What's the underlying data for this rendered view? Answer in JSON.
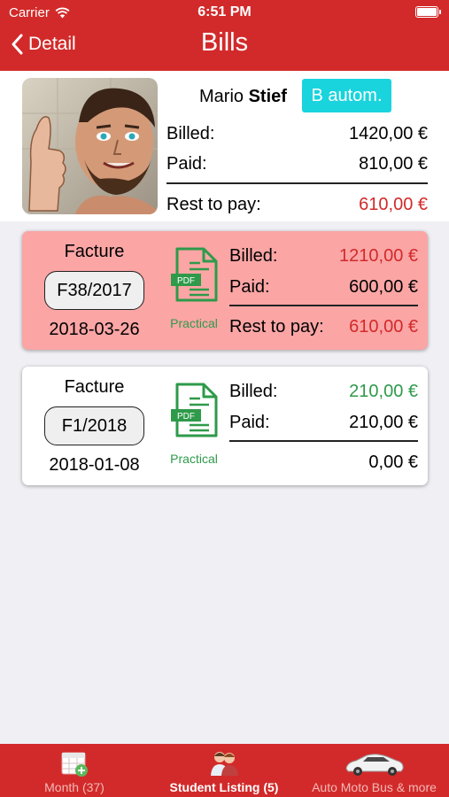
{
  "status_bar": {
    "carrier": "Carrier",
    "time": "6:51 PM"
  },
  "nav": {
    "back_label": "Detail",
    "title": "Bills"
  },
  "student": {
    "first_name": "Mario",
    "last_name": "Stief",
    "badge": "B autom.",
    "billed_label": "Billed:",
    "billed_value": "1420,00 €",
    "paid_label": "Paid:",
    "paid_value": "810,00 €",
    "rest_label": "Rest to pay:",
    "rest_value": "610,00 €"
  },
  "bills": [
    {
      "title": "Facture",
      "number": "F38/2017",
      "date": "2018-03-26",
      "pdf_label": "PDF",
      "category": "Practical",
      "billed_label": "Billed:",
      "billed_value": "1210,00 €",
      "paid_label": "Paid:",
      "paid_value": "600,00 €",
      "rest_label": "Rest to pay:",
      "rest_value": "610,00 €"
    },
    {
      "title": "Facture",
      "number": "F1/2018",
      "date": "2018-01-08",
      "pdf_label": "PDF",
      "category": "Practical",
      "billed_label": "Billed:",
      "billed_value": "210,00 €",
      "paid_label": "Paid:",
      "paid_value": "210,00 €",
      "rest_value": "0,00 €"
    }
  ],
  "tabs": [
    {
      "label": "Month (37)",
      "icon": "calendar-add-icon",
      "active": false
    },
    {
      "label": "Student Listing (5)",
      "icon": "students-icon",
      "active": true
    },
    {
      "label": "Auto Moto Bus & more",
      "icon": "car-icon",
      "active": false
    }
  ],
  "colors": {
    "brand": "#d22a2a",
    "badge": "#19d4dd",
    "overdue_card": "#fba5a5",
    "paid_green": "#2e9a4a"
  }
}
